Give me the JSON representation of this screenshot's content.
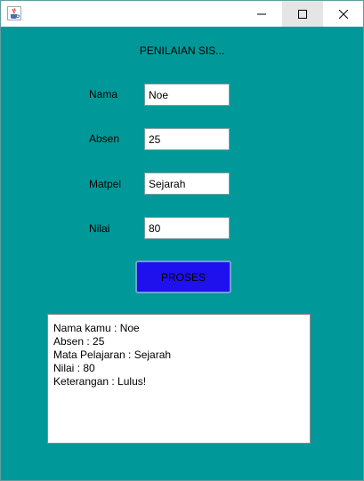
{
  "window": {
    "title": "",
    "icon": "java-coffee-cup-icon",
    "controls": {
      "minimize_icon": "minimize-icon",
      "maximize_icon": "maximize-icon",
      "close_icon": "close-icon"
    }
  },
  "form": {
    "title": "PENILAIAN SIS...",
    "fields": [
      {
        "label": "Nama",
        "value": "Noe"
      },
      {
        "label": "Absen",
        "value": "25"
      },
      {
        "label": "Matpel",
        "value": "Sejarah"
      },
      {
        "label": "Nilai",
        "value": "80"
      }
    ],
    "button_label": "PROSES"
  },
  "output": {
    "lines": [
      "Nama kamu : Noe",
      "Absen : 25",
      "Mata Pelajaran : Sejarah",
      "Nilai : 80",
      "Keterangan : Lulus!"
    ]
  },
  "colors": {
    "background": "#009898",
    "button": "#1f10ee"
  }
}
